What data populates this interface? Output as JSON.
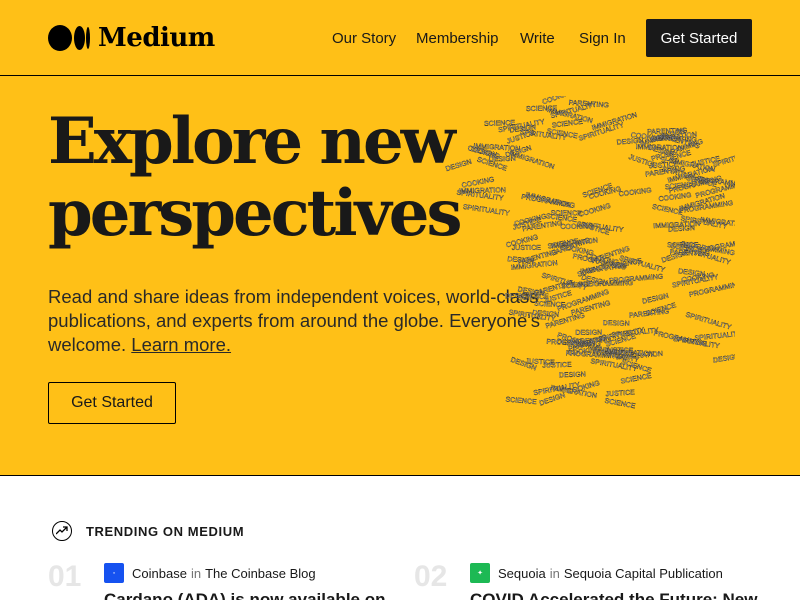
{
  "header": {
    "logo_text": "Medium",
    "nav": [
      "Our Story",
      "Membership",
      "Write",
      "Sign In"
    ],
    "cta_label": "Get Started"
  },
  "hero": {
    "title_line1": "Explore new",
    "title_line2": "perspectives",
    "description": "Read and share ideas from independent voices, world-class publications, and experts from around the globe. Everyone's welcome.",
    "learn_more": "Learn more.",
    "cta_label": "Get Started",
    "art_words": [
      "DESIGN",
      "SCIENCE",
      "COOKING",
      "PARENTING",
      "JUSTICE",
      "SPIRITUALITY",
      "PROGRAMMING",
      "IMMIGRATION"
    ]
  },
  "trending": {
    "label": "TRENDING ON MEDIUM",
    "items": [
      {
        "rank": "01",
        "author": "Coinbase",
        "in": "in",
        "publication": "The Coinbase Blog",
        "title": "Cardano (ADA) is now available on",
        "icon_color": "#1652f0"
      },
      {
        "rank": "02",
        "author": "Sequoia",
        "in": "in",
        "publication": "Sequoia Capital Publication",
        "title": "COVID Accelerated the Future: New",
        "icon_color": "#1db954"
      }
    ]
  },
  "colors": {
    "brand_yellow": "#ffc017",
    "ink": "#191919"
  }
}
